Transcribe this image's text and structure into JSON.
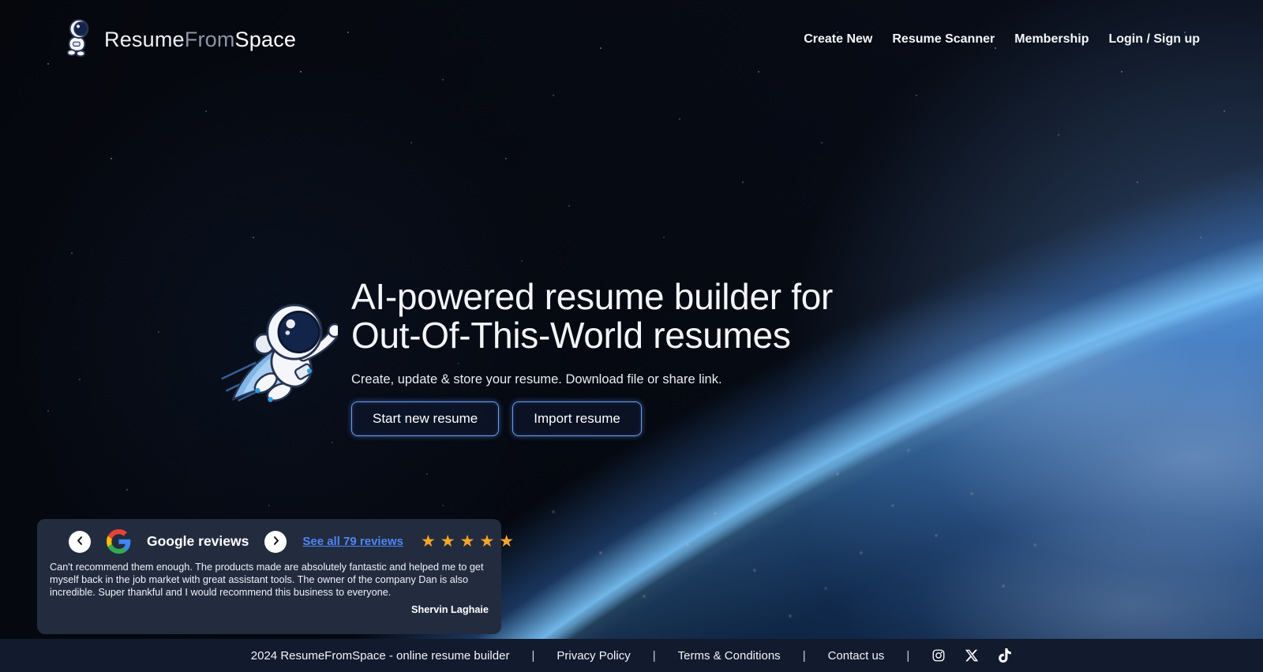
{
  "brand": {
    "name_parts": [
      "Resume",
      "From",
      "Space"
    ]
  },
  "nav": {
    "items": [
      "Create New",
      "Resume Scanner",
      "Membership",
      "Login / Sign up"
    ]
  },
  "hero": {
    "title_line1": "AI-powered resume builder for",
    "title_line2": "Out-Of-This-World resumes",
    "subtitle": "Create, update & store your resume. Download file or share link.",
    "primary_button": "Start new resume",
    "secondary_button": "Import resume"
  },
  "reviews": {
    "source_label": "Google reviews",
    "see_all_label": "See all 79 reviews",
    "rating_stars": 5,
    "stars_display": "★★★★★",
    "review_text": "Can't recommend them enough. The products made are absolutely fantastic and helped me to get myself back in the job market with great assistant tools. The owner of the company Dan is also incredible. Super thankful and I would recommend this business to everyone.",
    "reviewer_name": "Shervin Laghaie"
  },
  "footer": {
    "copyright": "2024 ResumeFromSpace - online resume builder",
    "links": [
      "Privacy Policy",
      "Terms & Conditions",
      "Contact us"
    ],
    "separator": "|",
    "social_icons": [
      "instagram-icon",
      "x-icon",
      "tiktok-icon"
    ]
  },
  "colors": {
    "accent_blue": "#6b9af0",
    "link_blue": "#4e86f7",
    "star_gold": "#f5a62c",
    "card_bg": "#232c3f",
    "footer_bg": "#121a2d",
    "earth_limb_glow": "#7cc8ff"
  }
}
